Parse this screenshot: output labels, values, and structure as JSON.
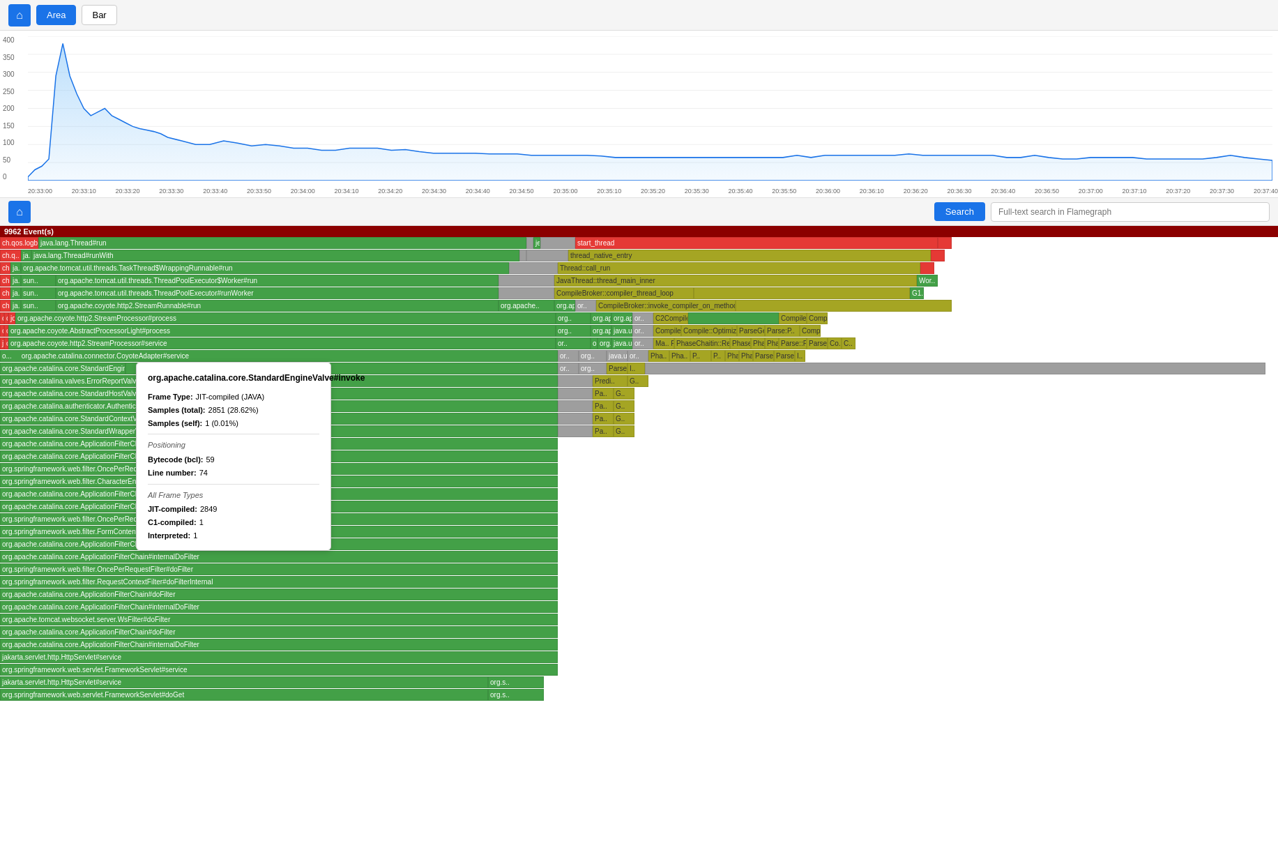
{
  "toolbar": {
    "home_label": "⌂",
    "area_label": "Area",
    "bar_label": "Bar"
  },
  "chart": {
    "y_labels": [
      "400",
      "350",
      "300",
      "250",
      "200",
      "150",
      "100",
      "50",
      "0"
    ],
    "x_labels": [
      "20:33:00",
      "20:33:10",
      "20:33:20",
      "20:33:30",
      "20:33:40",
      "20:33:50",
      "20:34:00",
      "20:34:10",
      "20:34:20",
      "20:34:30",
      "20:34:40",
      "20:34:50",
      "20:35:00",
      "20:35:10",
      "20:35:20",
      "20:35:30",
      "20:35:40",
      "20:35:50",
      "20:36:00",
      "20:36:10",
      "20:36:20",
      "20:36:30",
      "20:36:40",
      "20:36:50",
      "20:37:00",
      "20:37:10",
      "20:37:20",
      "20:37:30",
      "20:37:40"
    ]
  },
  "mid_toolbar": {
    "home_label": "⌂",
    "search_label": "Search",
    "search_placeholder": "Full-text search in Flamegraph"
  },
  "flamegraph": {
    "events_label": "9962 Event(s)",
    "tooltip": {
      "title": "org.apache.catalina.core.StandardEngineValve#invoke",
      "frame_type_label": "Frame Type:",
      "frame_type_value": "JIT-compiled (JAVA)",
      "samples_total_label": "Samples (total):",
      "samples_total_value": "2851 (28.62%)",
      "samples_self_label": "Samples (self):",
      "samples_self_value": "1 (0.01%)",
      "positioning_label": "Positioning",
      "bytecode_label": "Bytecode (bcl):",
      "bytecode_value": "59",
      "line_label": "Line number:",
      "line_value": "74",
      "all_frame_types_label": "All Frame Types",
      "jit_label": "JIT-compiled:",
      "jit_value": "2849",
      "c1_label": "C1-compiled:",
      "c1_value": "1",
      "interpreted_label": "Interpreted:",
      "interpreted_value": "1"
    }
  }
}
